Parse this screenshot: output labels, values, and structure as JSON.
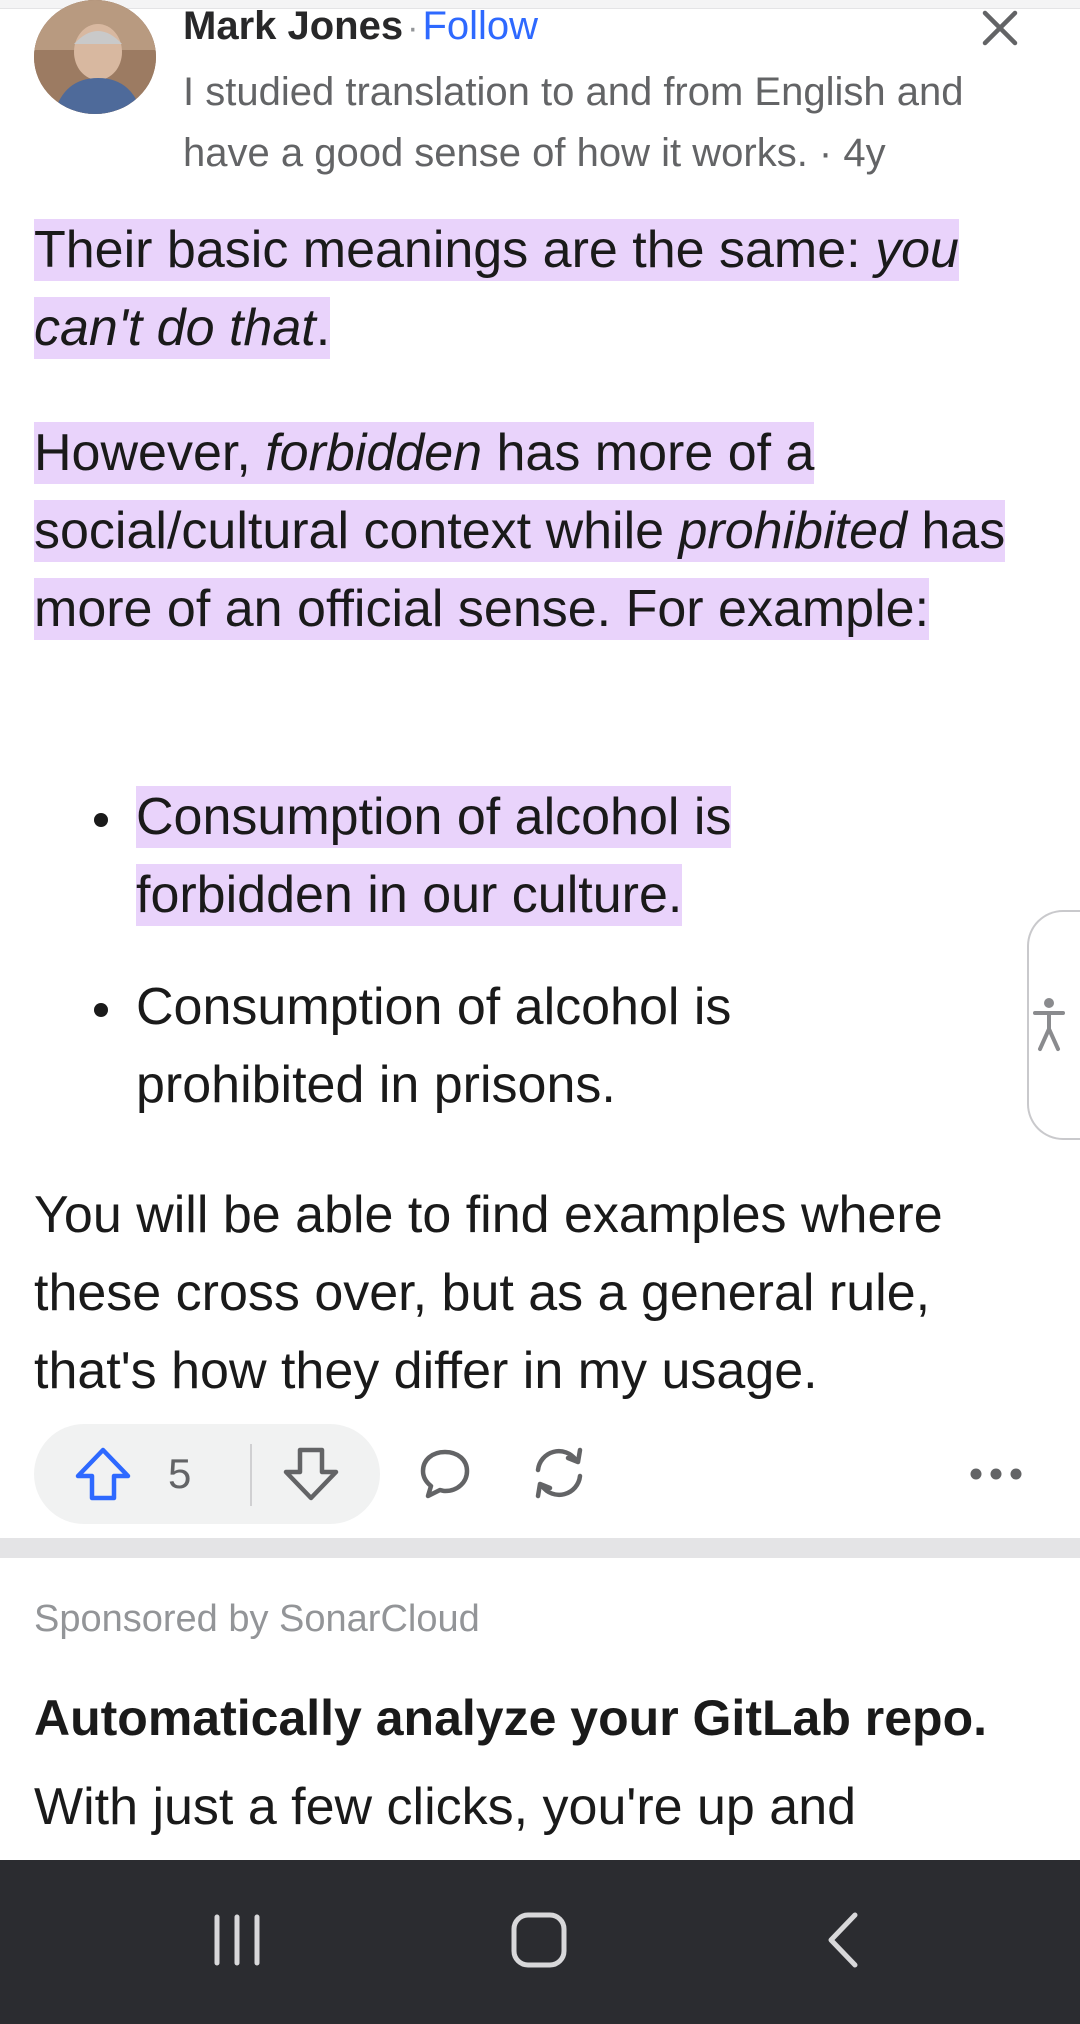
{
  "author": {
    "name": "Mark Jones",
    "separator": "·",
    "follow_label": "Follow",
    "credential": "I studied translation to and from English and have a good sense of how it works. · 4y"
  },
  "answer": {
    "p1": {
      "pre": "Their basic meanings are the same: ",
      "em": "you can't do that",
      "post": "."
    },
    "p2": {
      "a": "However, ",
      "em1": "forbidden",
      "b": " has more of a social/cultural context while ",
      "em2": "prohibited",
      "c": " has more of an official sense. For example:"
    },
    "bullets": [
      "Consumption of alcohol is forbidden in our culture.",
      "Consumption of alcohol is prohibited in prisons."
    ],
    "p3": "You will be able to find examples where these cross over, but as a general rule, that's how they differ in my usage."
  },
  "actions": {
    "upvote_count": "5",
    "icons": [
      "upvote-icon",
      "downvote-icon",
      "comment-icon",
      "share-icon",
      "more-icon"
    ]
  },
  "ad": {
    "sponsor": "Sponsored by SonarCloud",
    "title": "Automatically analyze your GitLab repo.",
    "text": "With just a few clicks, you're up and"
  },
  "nav": {
    "icons": [
      "recent-apps-icon",
      "home-icon",
      "back-icon"
    ]
  },
  "colors": {
    "highlight": "#e9d3fb",
    "follow": "#2e69ff",
    "upvote": "#2e69ff",
    "nav_bar": "#2b2c30"
  }
}
